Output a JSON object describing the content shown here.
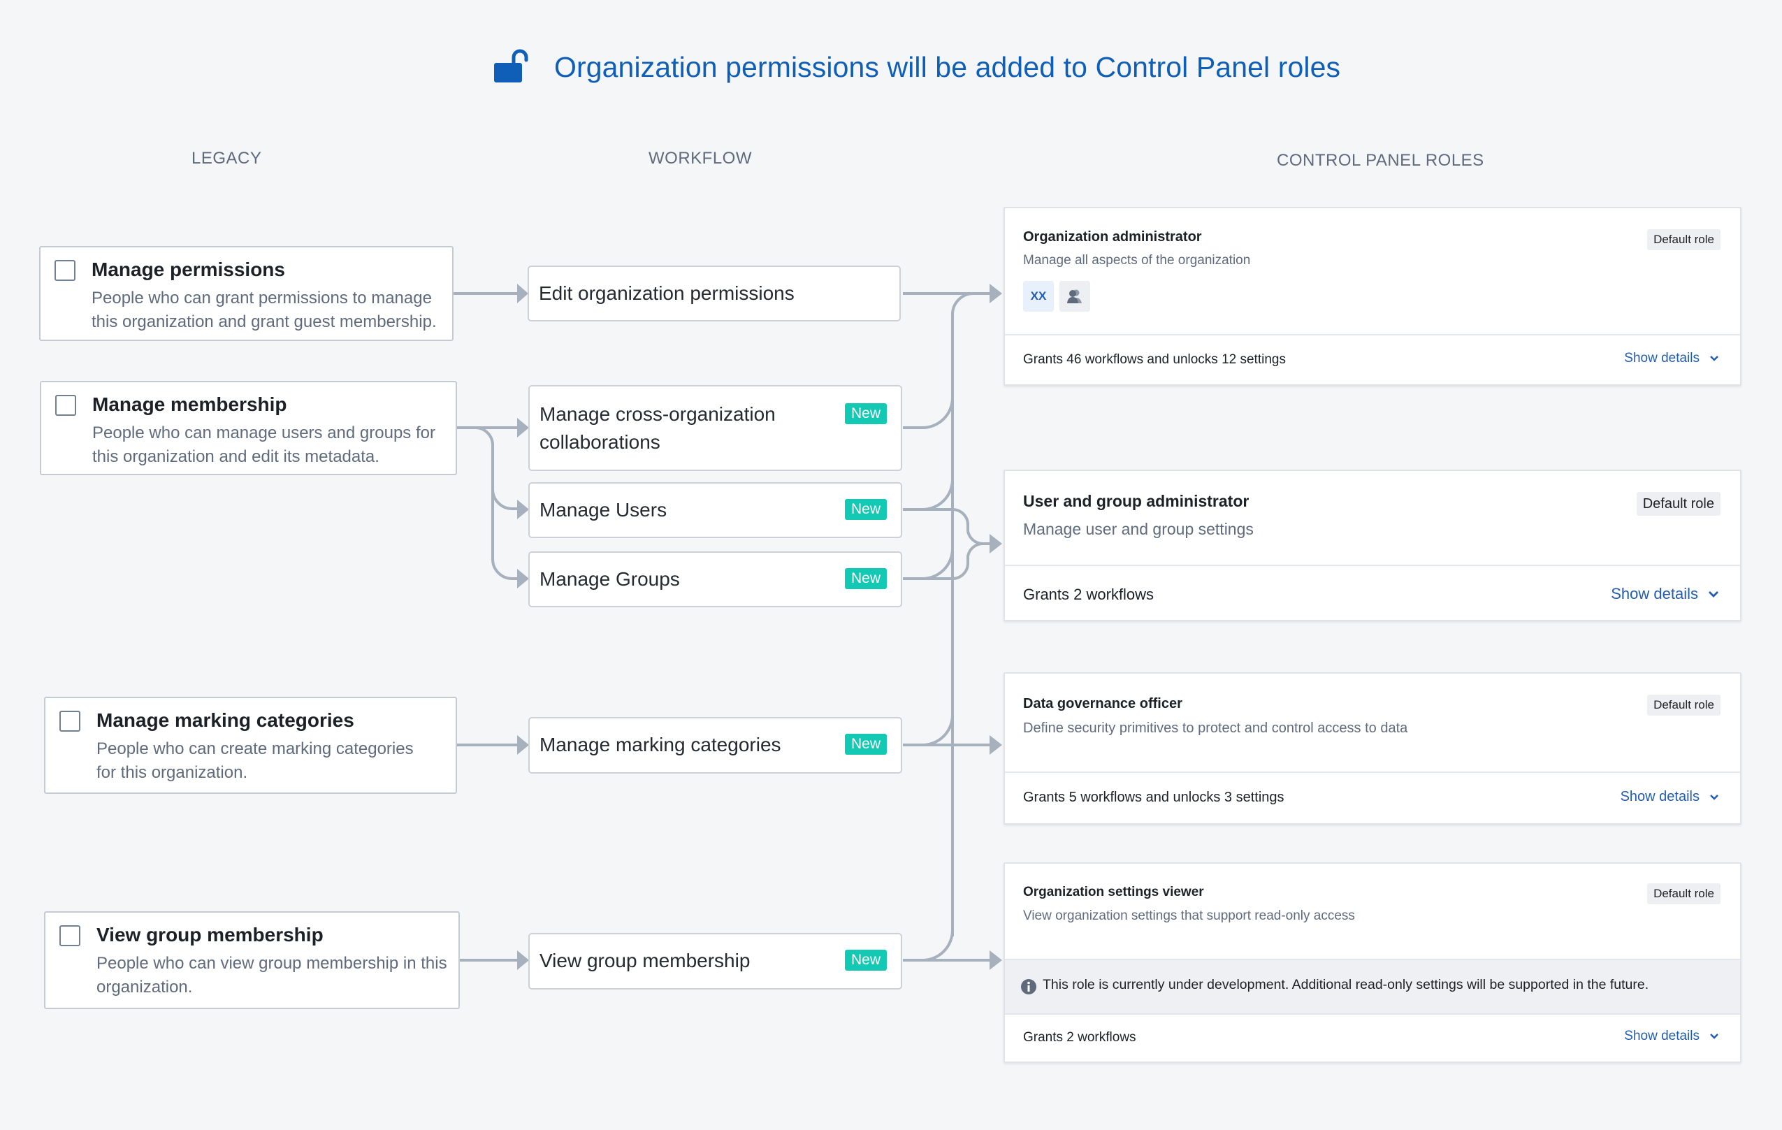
{
  "header": {
    "icon": "unlock-icon",
    "title": "Organization permissions will be added to Control Panel roles"
  },
  "columns": {
    "legacy": "LEGACY",
    "workflow": "WORKFLOW",
    "roles": "CONTROL PANEL ROLES"
  },
  "legacy": [
    {
      "title": "Manage permissions",
      "description": "People who can grant permissions to manage this organization and grant guest membership.",
      "checked": false
    },
    {
      "title": "Manage membership",
      "description": "People who can manage users and groups for this organization and edit its metadata.",
      "checked": false
    },
    {
      "title": "Manage marking categories",
      "description": "People who can create marking categories for this organization.",
      "checked": false
    },
    {
      "title": "View group membership",
      "description": "People who can view group membership in this organization.",
      "checked": false
    }
  ],
  "workflows": [
    {
      "title": "Edit organization permissions",
      "badge": null
    },
    {
      "title": "Manage cross-organization collaborations",
      "badge": "New"
    },
    {
      "title": "Manage Users",
      "badge": "New"
    },
    {
      "title": "Manage Groups",
      "badge": "New"
    },
    {
      "title": "Manage marking categories",
      "badge": "New"
    },
    {
      "title": "View group membership",
      "badge": "New"
    }
  ],
  "roles": [
    {
      "name": "Organization administrator",
      "description": "Manage all aspects of the organization",
      "badge": "Default role",
      "chips": [
        {
          "label": "XX",
          "icon": null
        },
        {
          "label": null,
          "icon": "people-icon"
        }
      ],
      "summary": "Grants 46 workflows and unlocks 12 settings",
      "action": "Show details"
    },
    {
      "name": "User and group administrator",
      "description": "Manage user and group settings",
      "badge": "Default role",
      "summary": "Grants 2 workflows",
      "action": "Show details"
    },
    {
      "name": "Data governance officer",
      "description": "Define security primitives to protect and control access to data",
      "badge": "Default role",
      "summary": "Grants 5 workflows and unlocks 3 settings",
      "action": "Show details"
    },
    {
      "name": "Organization settings viewer",
      "description": "View organization settings that support read-only access",
      "badge": "Default role",
      "callout": "This role is currently under development. Additional read-only settings will be supported in the future.",
      "summary": "Grants 2 workflows",
      "action": "Show details"
    }
  ],
  "mappings": {
    "legacy_to_workflow": [
      [
        0,
        0
      ],
      [
        1,
        1
      ],
      [
        1,
        2
      ],
      [
        1,
        3
      ],
      [
        2,
        4
      ],
      [
        3,
        5
      ]
    ],
    "workflow_to_role": [
      [
        0,
        0
      ],
      [
        1,
        0
      ],
      [
        2,
        0
      ],
      [
        3,
        0
      ],
      [
        4,
        0
      ],
      [
        5,
        0
      ],
      [
        2,
        1
      ],
      [
        3,
        1
      ],
      [
        4,
        2
      ],
      [
        5,
        3
      ]
    ]
  },
  "colors": {
    "accent": "#0f5fb8",
    "new_badge": "#13c9b4",
    "connector": "#a7b0bd",
    "link": "#215db0"
  }
}
